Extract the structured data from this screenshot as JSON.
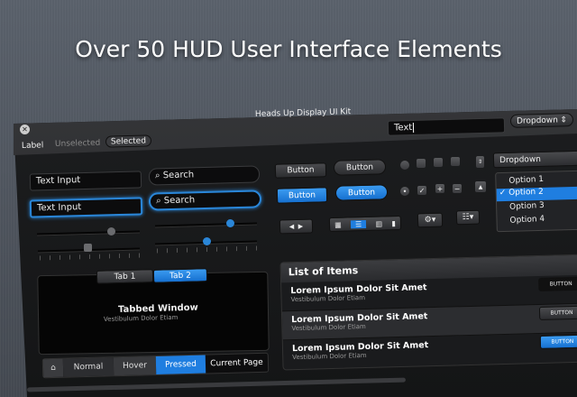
{
  "headline": "Over 50 HUD User Interface Elements",
  "window": {
    "title": "Heads Up Display UI Kit",
    "text_field": "Text",
    "dropdown": "Dropdown"
  },
  "toolbar": {
    "label": "Label",
    "unselected": "Unselected",
    "selected": "Selected"
  },
  "inputs": {
    "text_input": "Text Input",
    "search": "Search",
    "text_input_focused": "Text Input",
    "search_focused": "Search"
  },
  "sliders": {
    "slider1": 0.72,
    "slider2": 0.74,
    "slider3": 0.48,
    "slider4": 0.5
  },
  "buttons": {
    "b1": "Button",
    "b2": "Button",
    "b3": "Button",
    "b4": "Button"
  },
  "dropdown": {
    "value": "Dropdown",
    "options": [
      "Option 1",
      "Option 2",
      "Option 3",
      "Option 4"
    ],
    "selected": "Option 2",
    "check": "✓"
  },
  "tabs": {
    "tab1": "Tab 1",
    "tab2": "Tab 2",
    "title": "Tabbed Window",
    "subtitle": "Vestibulum Dolor Etiam"
  },
  "breadcrumb": [
    "Normal",
    "Hover",
    "Pressed",
    "Current Page"
  ],
  "list": {
    "title": "List of Items",
    "items": [
      {
        "title": "Lorem Ipsum Dolor Sit Amet",
        "subtitle": "Vestibulum Dolor Etiam",
        "button": "BUTTON"
      },
      {
        "title": "Lorem Ipsum Dolor Sit Amet",
        "subtitle": "Vestibulum Dolor Etiam",
        "button": "BUTTON"
      },
      {
        "title": "Lorem Ipsum Dolor Sit Amet",
        "subtitle": "Vestibulum Dolor Etiam",
        "button": "BUTTON"
      }
    ]
  },
  "colors": {
    "accent": "#2a86d8",
    "panel": "#1e1f21"
  }
}
